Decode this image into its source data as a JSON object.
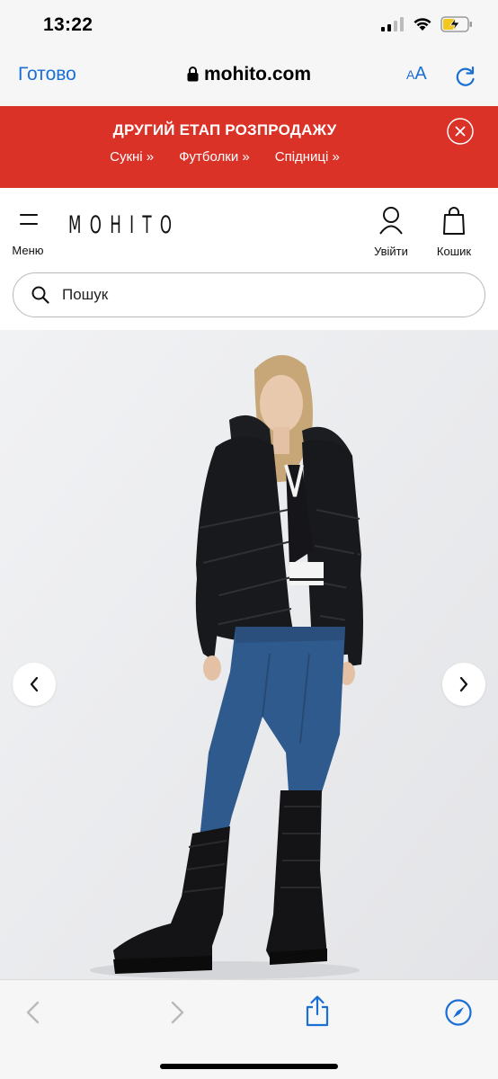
{
  "status_bar": {
    "time": "13:22",
    "icons": [
      "signal-icon",
      "wifi-icon",
      "battery-charging-icon"
    ]
  },
  "safari": {
    "done_label": "Готово",
    "url": "mohito.com",
    "text_size_label_small": "A",
    "text_size_label_large": "A"
  },
  "promo": {
    "title": "ДРУГИЙ ЕТАП РОЗПРОДАЖУ",
    "links": [
      {
        "label": "Сукні »"
      },
      {
        "label": "Футболки »"
      },
      {
        "label": "Спідниці »"
      }
    ],
    "background_color": "#db3228"
  },
  "header": {
    "menu_label": "Меню",
    "logo": "MOHITO",
    "login_label": "Увійти",
    "cart_label": "Кошик"
  },
  "search": {
    "placeholder": "Пошук"
  },
  "product": {
    "image_description_icon": "product-photo"
  },
  "colors": {
    "accent": "#1a6fd4",
    "promo_red": "#db3228"
  }
}
